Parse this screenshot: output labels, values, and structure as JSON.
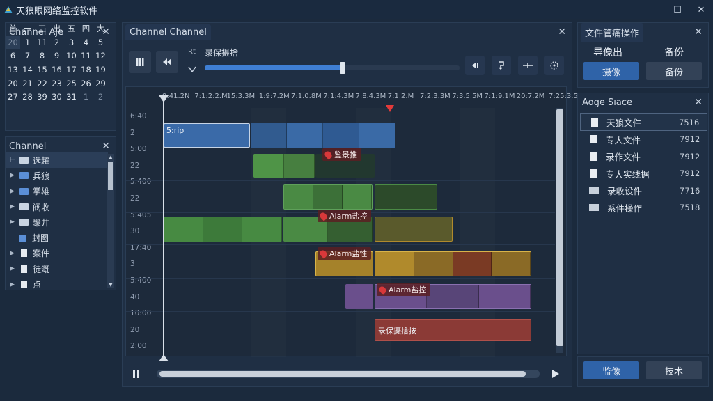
{
  "window": {
    "title": "天狼眼网络监控软件",
    "controls": [
      "—",
      "☐",
      "✕"
    ]
  },
  "calendar": {
    "tab": "Channel Aje",
    "days": [
      [
        "首",
        "一",
        "工",
        "出",
        "五",
        "四",
        "大"
      ],
      [
        "20",
        "1",
        "11",
        "2",
        "3",
        "4",
        "5"
      ],
      [
        "6",
        "7",
        "8",
        "9",
        "10",
        "11",
        "12"
      ],
      [
        "13",
        "14",
        "15",
        "16",
        "17",
        "18",
        "19"
      ],
      [
        "20",
        "21",
        "22",
        "23",
        "25",
        "26",
        "29"
      ],
      [
        "27",
        "28",
        "39",
        "30",
        "31",
        "1",
        "2"
      ]
    ]
  },
  "channel_tree": {
    "title": "Channel",
    "items": [
      {
        "label": "选趯",
        "type": "root"
      },
      {
        "label": "兵狼",
        "type": "folder"
      },
      {
        "label": "掌雄",
        "type": "folder"
      },
      {
        "label": "阀收",
        "type": "folder"
      },
      {
        "label": "聚井",
        "type": "folder"
      },
      {
        "label": "封图",
        "type": "check"
      },
      {
        "label": "案件",
        "type": "doc"
      },
      {
        "label": "徒溉",
        "type": "doc"
      },
      {
        "label": "点",
        "type": "doc"
      }
    ]
  },
  "center": {
    "tab": "Channel Channel",
    "speed_label": "Rt",
    "track_label": "录保摄捨",
    "progress": 0.54,
    "ruler": [
      "9:41.2N",
      "7:1:2:2.M",
      "15:3.3M",
      "1:9:7.2M",
      "7:1.0.8M",
      "7:1:4.3M",
      "7:8.4.3M",
      "7:1.2.M",
      "7:2.3.3M",
      "7:3.5.5M",
      "7:1:9.1M",
      "20:7.2M",
      "7:25:3.5M"
    ],
    "row_labels": [
      "6:40",
      "2",
      "5:00",
      "22",
      "5:400",
      "22",
      "5:405",
      "30",
      "17:40",
      "3",
      "5:400",
      "40",
      "10:00",
      "20",
      "2:00"
    ],
    "clips": [
      {
        "label": "5:rip"
      }
    ],
    "alarms": [
      "鉴景推",
      "Alarm盐控",
      "Alarm盐性",
      "Alarm盐控"
    ],
    "event_label": "录保摄捨按",
    "colors": {
      "blue": "#3a6aa8",
      "green": "#3f7a3c",
      "yellow": "#b08a2c",
      "purple": "#6a4f8c",
      "red": "#8b3a36"
    }
  },
  "file_ops": {
    "tab": "文件管痛操作",
    "export_label": "导像出",
    "backup_label": "备份",
    "btn_record": "摄像",
    "btn_backup": "备份"
  },
  "file_list": {
    "title": "Aoge Sıace",
    "items": [
      {
        "name": "天狼文件",
        "size": "7516"
      },
      {
        "name": "专大文件",
        "size": "7912"
      },
      {
        "name": "录作文件",
        "size": "7912"
      },
      {
        "name": "专大实线据",
        "size": "7912"
      },
      {
        "name": "录收设件",
        "size": "7716"
      },
      {
        "name": "系件操作",
        "size": "7518"
      }
    ]
  },
  "bottom_buttons": {
    "left": "监像",
    "right": "技术"
  }
}
